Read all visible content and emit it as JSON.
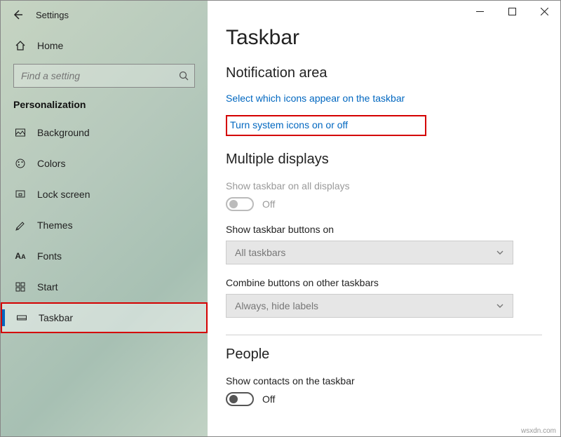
{
  "window": {
    "title": "Settings"
  },
  "sidebar": {
    "home_label": "Home",
    "search_placeholder": "Find a setting",
    "category": "Personalization",
    "items": [
      {
        "label": "Background"
      },
      {
        "label": "Colors"
      },
      {
        "label": "Lock screen"
      },
      {
        "label": "Themes"
      },
      {
        "label": "Fonts"
      },
      {
        "label": "Start"
      },
      {
        "label": "Taskbar"
      }
    ]
  },
  "main": {
    "title": "Taskbar",
    "notification_area": {
      "heading": "Notification area",
      "link1": "Select which icons appear on the taskbar",
      "link2": "Turn system icons on or off"
    },
    "multiple_displays": {
      "heading": "Multiple displays",
      "show_all_label": "Show taskbar on all displays",
      "show_all_state": "Off",
      "buttons_on_label": "Show taskbar buttons on",
      "buttons_on_value": "All taskbars",
      "combine_label": "Combine buttons on other taskbars",
      "combine_value": "Always, hide labels"
    },
    "people": {
      "heading": "People",
      "show_contacts_label": "Show contacts on the taskbar",
      "show_contacts_state": "Off"
    }
  },
  "watermark": "wsxdn.com"
}
